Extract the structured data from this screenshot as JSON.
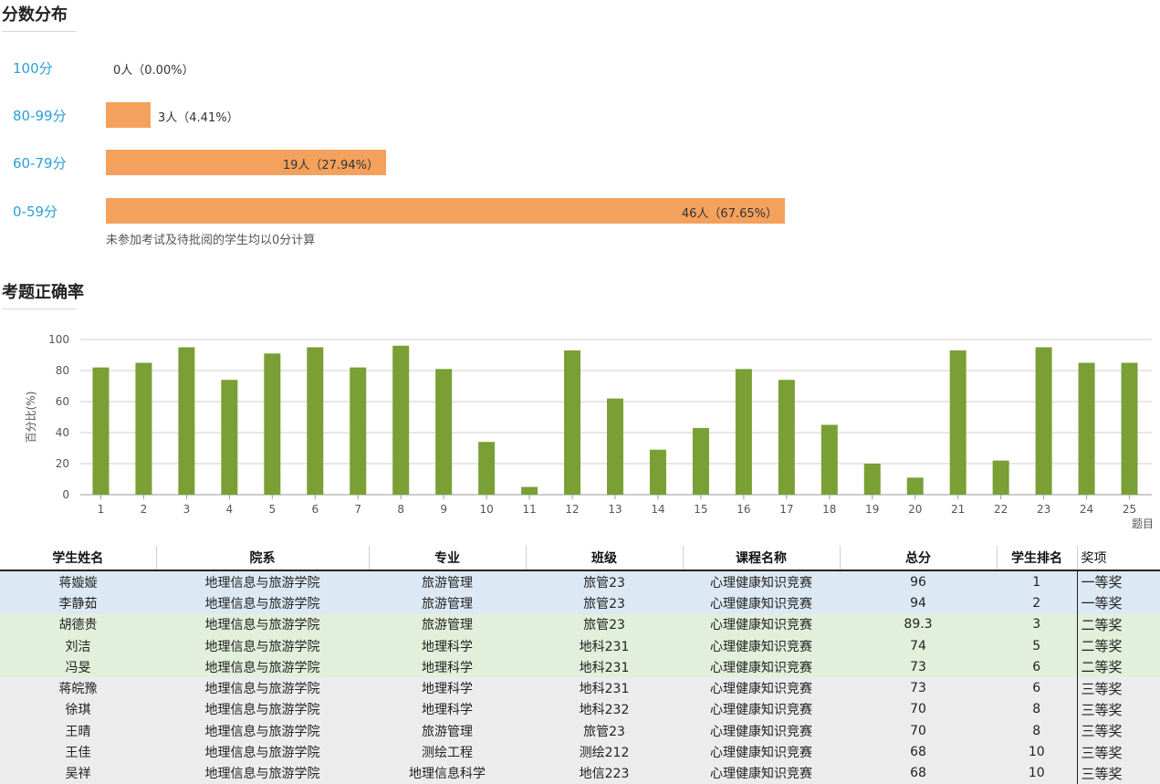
{
  "distribution": {
    "title": "分数分布",
    "rows": [
      {
        "label": "100分",
        "text": "0人（0.00%）",
        "percent": 0.0
      },
      {
        "label": "80-99分",
        "text": "3人（4.41%）",
        "percent": 4.41
      },
      {
        "label": "60-79分",
        "text": "19人（27.94%）",
        "percent": 27.94
      },
      {
        "label": "0-59分",
        "text": "46人（67.65%）",
        "percent": 67.65
      }
    ],
    "note": "未参加考试及待批阅的学生均以0分计算"
  },
  "accuracy": {
    "title": "考题正确率"
  },
  "chart_data": {
    "type": "bar",
    "ylabel": "百分比(%)",
    "xlabel": "题目",
    "ylim": [
      0,
      100
    ],
    "yticks": [
      0,
      20,
      40,
      60,
      80,
      100
    ],
    "grid": true,
    "color": "#7a9f35",
    "categories": [
      "1",
      "2",
      "3",
      "4",
      "5",
      "6",
      "7",
      "8",
      "9",
      "10",
      "11",
      "12",
      "13",
      "14",
      "15",
      "16",
      "17",
      "18",
      "19",
      "20",
      "21",
      "22",
      "23",
      "24",
      "25"
    ],
    "values": [
      82,
      85,
      95,
      74,
      91,
      95,
      82,
      96,
      81,
      34,
      5,
      93,
      62,
      29,
      43,
      81,
      74,
      45,
      20,
      11,
      93,
      22,
      95,
      85,
      85
    ]
  },
  "table": {
    "headers": [
      "学生姓名",
      "院系",
      "专业",
      "班级",
      "课程名称",
      "总分",
      "学生排名",
      "奖项"
    ],
    "rows": [
      {
        "band": "blue",
        "cells": [
          "蒋嫙嫙",
          "地理信息与旅游学院",
          "旅游管理",
          "旅管23",
          "心理健康知识竞赛",
          "96",
          "1",
          "一等奖"
        ]
      },
      {
        "band": "blue",
        "cells": [
          "李静茹",
          "地理信息与旅游学院",
          "旅游管理",
          "旅管23",
          "心理健康知识竞赛",
          "94",
          "2",
          "一等奖"
        ]
      },
      {
        "band": "green",
        "cells": [
          "胡德贵",
          "地理信息与旅游学院",
          "旅游管理",
          "旅管23",
          "心理健康知识竞赛",
          "89.3",
          "3",
          "二等奖"
        ]
      },
      {
        "band": "green",
        "cells": [
          "刘洁",
          "地理信息与旅游学院",
          "地理科学",
          "地科231",
          "心理健康知识竞赛",
          "74",
          "5",
          "二等奖"
        ]
      },
      {
        "band": "green",
        "cells": [
          "冯旻",
          "地理信息与旅游学院",
          "地理科学",
          "地科231",
          "心理健康知识竞赛",
          "73",
          "6",
          "二等奖"
        ]
      },
      {
        "band": "gray",
        "cells": [
          "蒋皖豫",
          "地理信息与旅游学院",
          "地理科学",
          "地科231",
          "心理健康知识竞赛",
          "73",
          "6",
          "三等奖"
        ]
      },
      {
        "band": "gray",
        "cells": [
          "徐琪",
          "地理信息与旅游学院",
          "地理科学",
          "地科232",
          "心理健康知识竞赛",
          "70",
          "8",
          "三等奖"
        ]
      },
      {
        "band": "gray",
        "cells": [
          "王晴",
          "地理信息与旅游学院",
          "旅游管理",
          "旅管23",
          "心理健康知识竞赛",
          "70",
          "8",
          "三等奖"
        ]
      },
      {
        "band": "gray",
        "cells": [
          "王佳",
          "地理信息与旅游学院",
          "测绘工程",
          "测绘212",
          "心理健康知识竞赛",
          "68",
          "10",
          "三等奖"
        ]
      },
      {
        "band": "gray",
        "cells": [
          "吴祥",
          "地理信息与旅游学院",
          "地理信息科学",
          "地信223",
          "心理健康知识竞赛",
          "68",
          "10",
          "三等奖"
        ]
      }
    ]
  }
}
